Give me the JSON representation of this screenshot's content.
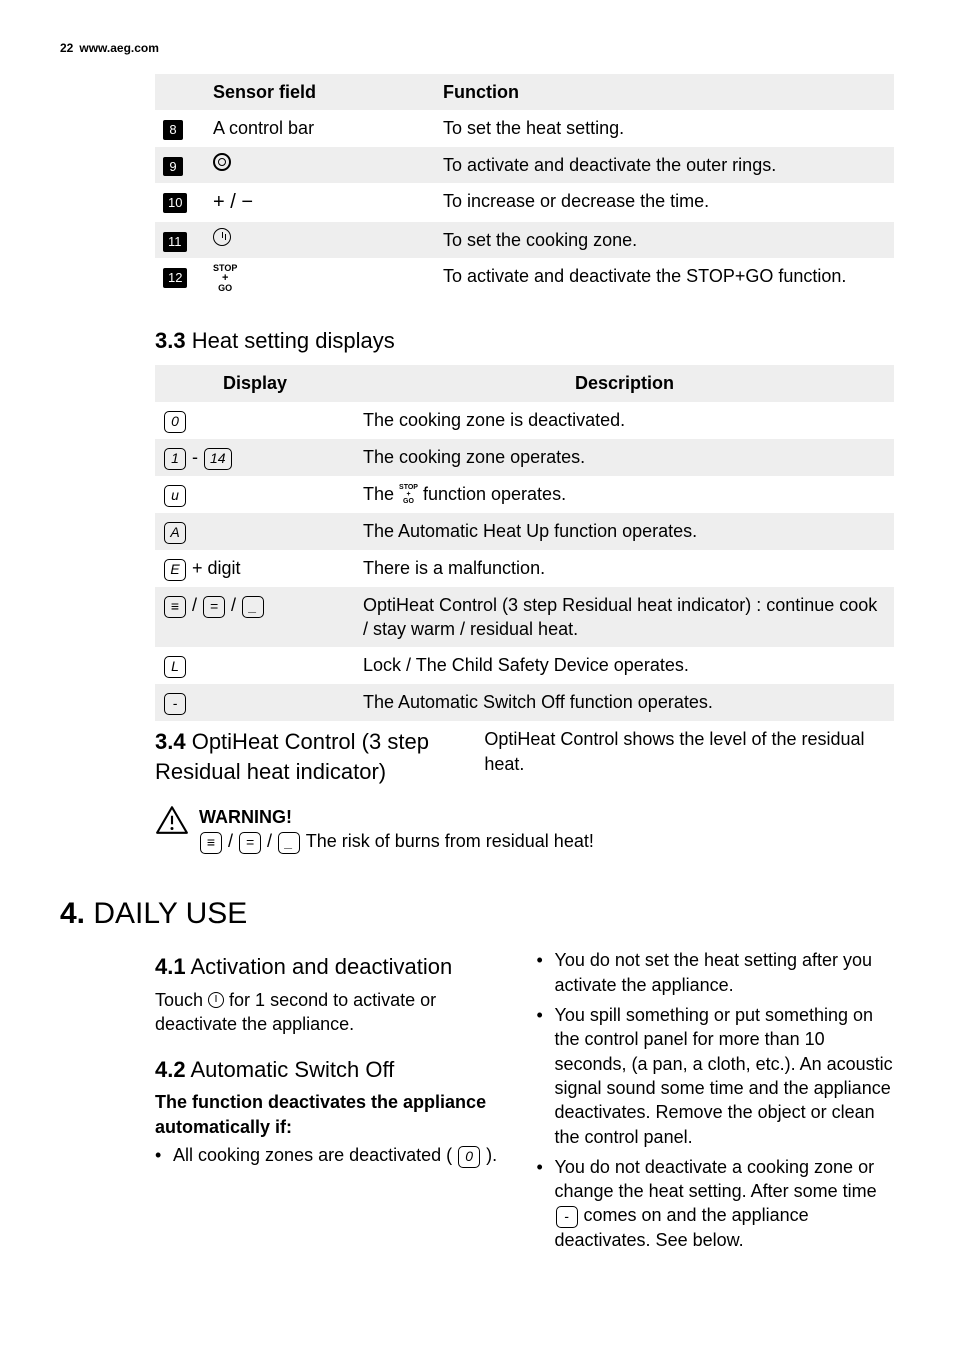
{
  "header": {
    "page": "22",
    "url": "www.aeg.com"
  },
  "table1": {
    "head": {
      "sensor": "Sensor field",
      "func": "Function"
    },
    "rows": [
      {
        "n": "8",
        "sensor": "A control bar",
        "func": "To set the heat setting."
      },
      {
        "n": "9",
        "func": "To activate and deactivate the outer rings."
      },
      {
        "n": "10",
        "sensor": "+ / −",
        "func": "To increase or decrease the time."
      },
      {
        "n": "11",
        "func": "To set the cooking zone."
      },
      {
        "n": "12",
        "func": "To activate and deactivate the STOP+GO function."
      }
    ]
  },
  "sec33": {
    "title_n": "3.3",
    "title": " Heat setting displays"
  },
  "table2": {
    "head": {
      "disp": "Display",
      "desc": "Description"
    },
    "rows": [
      {
        "disp": "0",
        "desc": "The cooking zone is deactivated."
      },
      {
        "disp_a": "1",
        "disp_sep": " - ",
        "disp_b": "14",
        "desc": "The cooking zone operates."
      },
      {
        "disp": "u",
        "desc_pre": "The ",
        "desc_post": " function operates."
      },
      {
        "disp": "A",
        "desc": "The Automatic Heat Up function operates."
      },
      {
        "disp": "E",
        "disp_suffix": " + digit",
        "desc": "There is a malfunction."
      },
      {
        "disp_multi": [
          "≡",
          "=",
          "_"
        ],
        "desc": "OptiHeat Control (3 step Residual heat indicator) : continue cook / stay warm / residual heat."
      },
      {
        "disp": "L",
        "desc": "Lock / The Child Safety Device operates."
      },
      {
        "disp": "-",
        "desc": "The Automatic Switch Off function operates."
      }
    ]
  },
  "sec34": {
    "title_n": "3.4",
    "title": " OptiHeat Control (3 step Residual heat indicator)",
    "right": "OptiHeat Control shows the level of the residual heat."
  },
  "warn": {
    "title": "WARNING!",
    "body_pre": "",
    "body_post": " The risk of burns from residual heat!",
    "segs": [
      "≡",
      "=",
      "_"
    ]
  },
  "chap4": {
    "n": "4.",
    "title": " DAILY USE"
  },
  "sec41": {
    "n": "4.1",
    "title": " Activation and deactivation",
    "body_pre": "Touch ",
    "body_post": " for 1 second to activate or deactivate the appliance."
  },
  "sec42": {
    "n": "4.2",
    "title": " Automatic Switch Off",
    "lead": "The function deactivates the appliance automatically if:",
    "left_bullets": [
      {
        "pre": "All cooking zones are deactivated ( ",
        "seg": "0",
        "post": " )."
      }
    ],
    "right_bullets": [
      {
        "text": "You do not set the heat setting after you activate the appliance."
      },
      {
        "text": "You spill something or put something on the control panel for more than 10 seconds, (a pan, a cloth, etc.). An acoustic signal sound some time and the appliance deactivates. Remove the object or clean the control panel."
      },
      {
        "pre": "You do not deactivate a cooking zone or change the heat setting. After some time ",
        "seg": "-",
        "post": " comes on and the appliance deactivates. See below."
      }
    ]
  }
}
